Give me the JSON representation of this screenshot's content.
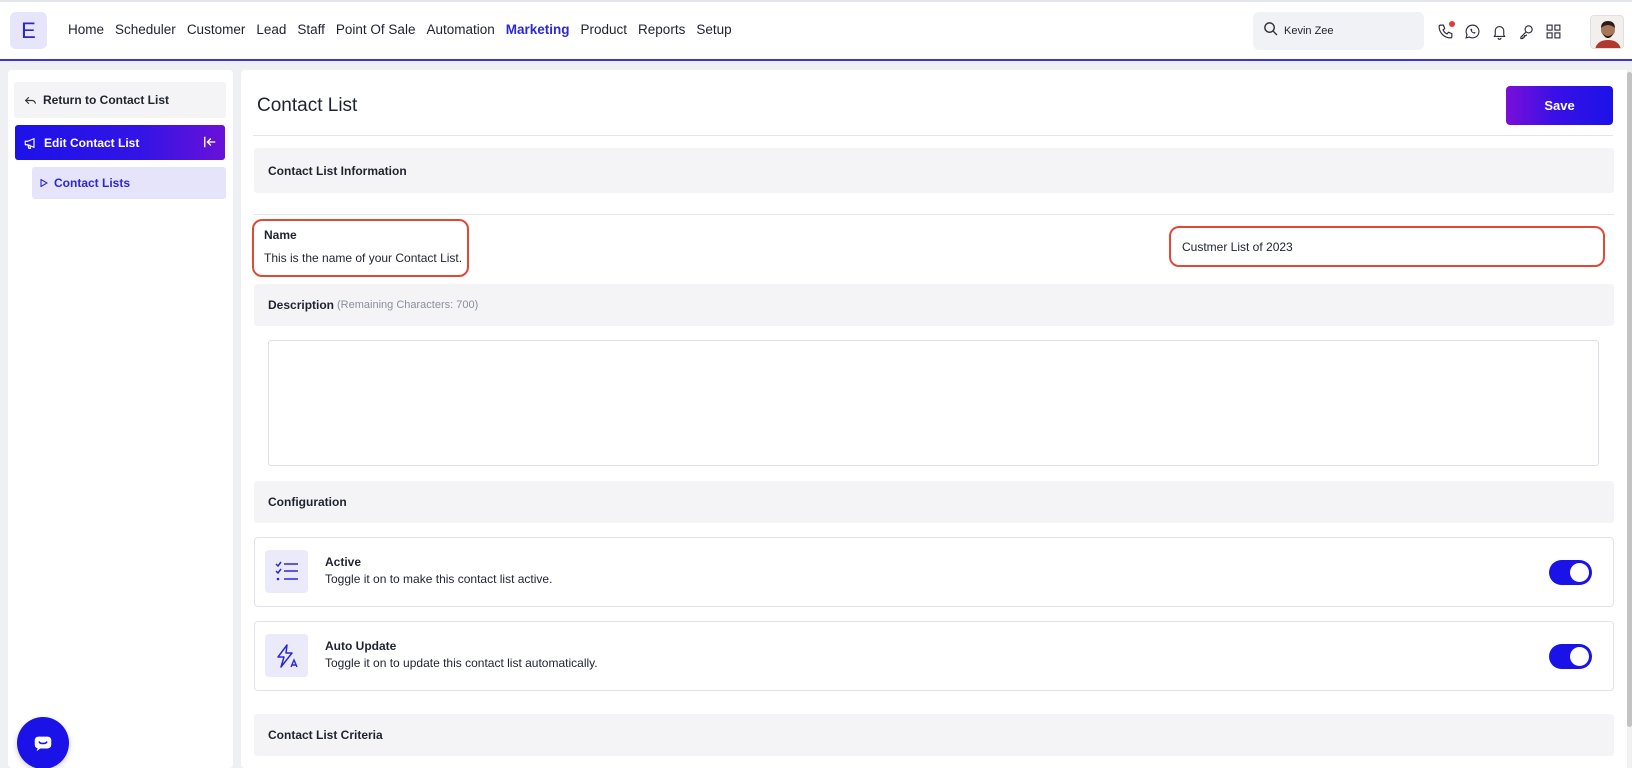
{
  "logo": {
    "letter": "E"
  },
  "nav": {
    "items": [
      "Home",
      "Scheduler",
      "Customer",
      "Lead",
      "Staff",
      "Point Of Sale",
      "Automation",
      "Marketing",
      "Product",
      "Reports",
      "Setup"
    ],
    "active": "Marketing"
  },
  "search": {
    "value": "Kevin Zee"
  },
  "top_icons": [
    "phone-icon",
    "whatsapp-icon",
    "bell-icon",
    "key-icon",
    "grid-icon"
  ],
  "sidebar": {
    "return_label": "Return to Contact List",
    "edit_label": "Edit Contact List",
    "sub_label": "Contact Lists"
  },
  "main": {
    "title": "Contact List",
    "save_label": "Save",
    "info_section": "Contact List Information",
    "name_label": "Name",
    "name_help": "This is the name of your Contact List.",
    "name_value": "Custmer List of 2023",
    "description_label": "Description",
    "description_hint": "(Remaining Characters: 700)",
    "description_value": "",
    "config_section": "Configuration",
    "active": {
      "title": "Active",
      "desc": "Toggle it on to make this contact list active.",
      "on": true
    },
    "auto_update": {
      "title": "Auto Update",
      "desc": "Toggle it on to update this contact list automatically.",
      "on": true
    },
    "criteria_section": "Contact List Criteria"
  },
  "colors": {
    "accent": "#1a12e6",
    "highlight_border": "#df4a37",
    "nav_active": "#2c27d6"
  }
}
